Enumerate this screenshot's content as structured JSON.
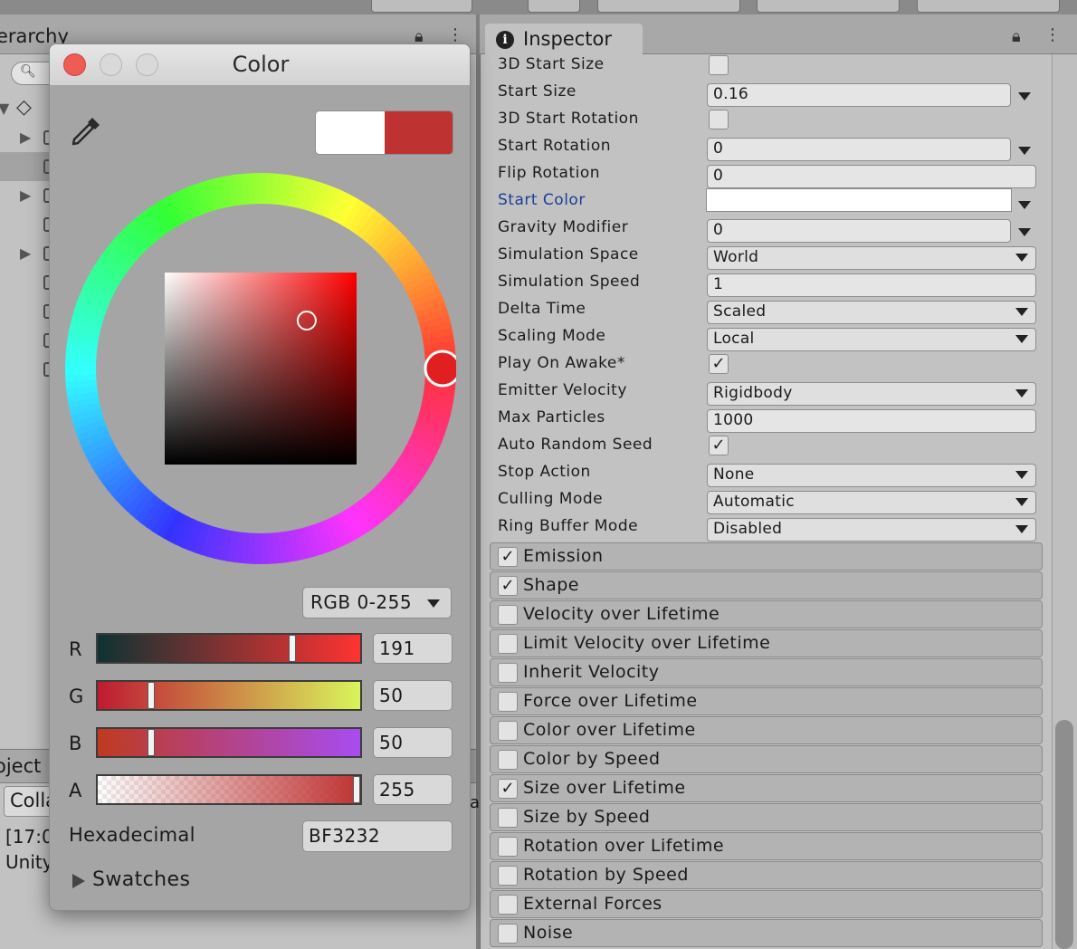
{
  "colors": {
    "picked": "#bf3232",
    "previous": "#ffffff",
    "start_color": "#ffffff",
    "dialog_bg": "#a5a5a5"
  },
  "hierarchy": {
    "tab_label": "erarchy"
  },
  "project": {
    "tab_label": "oject",
    "collapse_label": "Colla",
    "console_line1": "[17:0",
    "console_line2": "Unity",
    "console_cut": "a"
  },
  "inspector": {
    "tab_label": "Inspector",
    "tab_icon": "info-icon",
    "properties": [
      {
        "label": "3D Start Size",
        "kind": "checkbox",
        "checked": false
      },
      {
        "label": "Start Size",
        "kind": "field",
        "value": "0.16",
        "side_menu": true
      },
      {
        "label": "3D Start Rotation",
        "kind": "checkbox",
        "checked": false
      },
      {
        "label": "Start Rotation",
        "kind": "field",
        "value": "0",
        "side_menu": true
      },
      {
        "label": "Flip Rotation",
        "kind": "field",
        "value": "0",
        "side_menu": false
      },
      {
        "label": "Start Color",
        "kind": "color",
        "value": "",
        "side_menu": true
      },
      {
        "label": "Gravity Modifier",
        "kind": "field",
        "value": "0",
        "side_menu": true
      },
      {
        "label": "Simulation Space",
        "kind": "dropdown",
        "value": "World"
      },
      {
        "label": "Simulation Speed",
        "kind": "field",
        "value": "1",
        "side_menu": false
      },
      {
        "label": "Delta Time",
        "kind": "dropdown",
        "value": "Scaled"
      },
      {
        "label": "Scaling Mode",
        "kind": "dropdown",
        "value": "Local"
      },
      {
        "label": "Play On Awake*",
        "kind": "checkbox",
        "checked": true
      },
      {
        "label": "Emitter Velocity",
        "kind": "dropdown",
        "value": "Rigidbody"
      },
      {
        "label": "Max Particles",
        "kind": "field",
        "value": "1000",
        "side_menu": false
      },
      {
        "label": "Auto Random Seed",
        "kind": "checkbox",
        "checked": true
      },
      {
        "label": "Stop Action",
        "kind": "dropdown",
        "value": "None"
      },
      {
        "label": "Culling Mode",
        "kind": "dropdown",
        "value": "Automatic"
      },
      {
        "label": "Ring Buffer Mode",
        "kind": "dropdown",
        "value": "Disabled"
      }
    ],
    "modules": [
      {
        "label": "Emission",
        "enabled": true
      },
      {
        "label": "Shape",
        "enabled": true
      },
      {
        "label": "Velocity over Lifetime",
        "enabled": false
      },
      {
        "label": "Limit Velocity over Lifetime",
        "enabled": false
      },
      {
        "label": "Inherit Velocity",
        "enabled": false
      },
      {
        "label": "Force over Lifetime",
        "enabled": false
      },
      {
        "label": "Color over Lifetime",
        "enabled": false
      },
      {
        "label": "Color by Speed",
        "enabled": false
      },
      {
        "label": "Size over Lifetime",
        "enabled": true
      },
      {
        "label": "Size by Speed",
        "enabled": false
      },
      {
        "label": "Rotation over Lifetime",
        "enabled": false
      },
      {
        "label": "Rotation by Speed",
        "enabled": false
      },
      {
        "label": "External Forces",
        "enabled": false
      },
      {
        "label": "Noise",
        "enabled": false
      }
    ]
  },
  "color_dialog": {
    "title": "Color",
    "mode": "RGB 0-255",
    "channels": [
      {
        "label": "R",
        "value": "191",
        "level": 191
      },
      {
        "label": "G",
        "value": "50",
        "level": 50
      },
      {
        "label": "B",
        "value": "50",
        "level": 50
      },
      {
        "label": "A",
        "value": "255",
        "level": 255
      }
    ],
    "hex_label": "Hexadecimal",
    "hex_value": "BF3232",
    "swatches_label": "Swatches",
    "hue_degrees": 0,
    "saturation": 0.74,
    "brightness": 0.75
  }
}
